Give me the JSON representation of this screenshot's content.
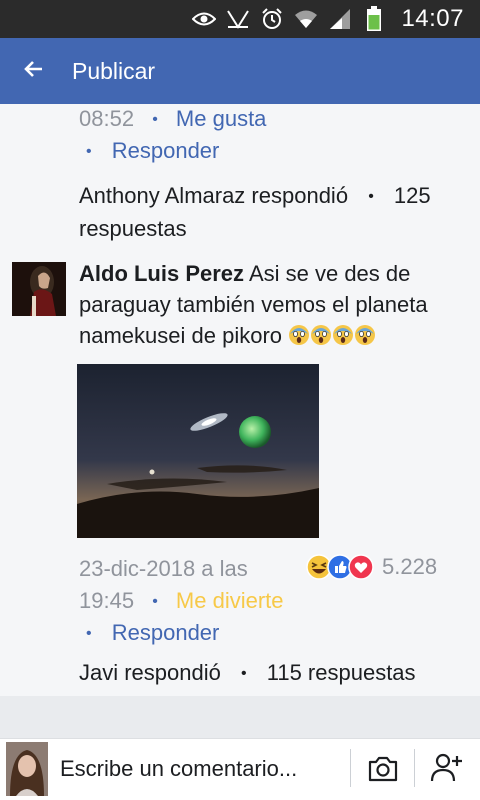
{
  "status_bar": {
    "time": "14:07",
    "icons": [
      "eye-icon",
      "nfc-icon",
      "alarm-icon",
      "wifi-icon",
      "signal-icon",
      "battery-icon"
    ]
  },
  "app_bar": {
    "title": "Publicar",
    "back_icon": "arrow-left-icon"
  },
  "prev_comment": {
    "timestamp": "08:52",
    "like_label": "Me gusta",
    "reply_label": "Responder",
    "reply_summary": "Anthony Almaraz respondió",
    "reply_count_line1": "125",
    "reply_count_line2": "respuestas"
  },
  "comment": {
    "author": "Aldo Luis Perez",
    "text_before": " Asi se ve des de paraguay también vemos el planeta namekusei de pikoro",
    "emoji": [
      "scream",
      "scream",
      "scream",
      "scream"
    ],
    "date_line1": "23-dic-2018 a las",
    "date_line2": "19:45",
    "reaction_label": "Me divierte",
    "reaction_color": "#f7c948",
    "reply_label": "Responder",
    "reactions": [
      "haha-icon",
      "like-icon",
      "love-icon"
    ],
    "reaction_count": "5.228",
    "reply_summary": "Javi respondió",
    "reply_count": "115 respuestas"
  },
  "composer": {
    "placeholder": "Escribe un comentario...",
    "camera_icon": "camera-icon",
    "add_friend_icon": "add-person-icon"
  },
  "colors": {
    "brand_blue": "#4267b2",
    "status_bar": "#2b2b2b",
    "meta_gray": "#90949c"
  }
}
